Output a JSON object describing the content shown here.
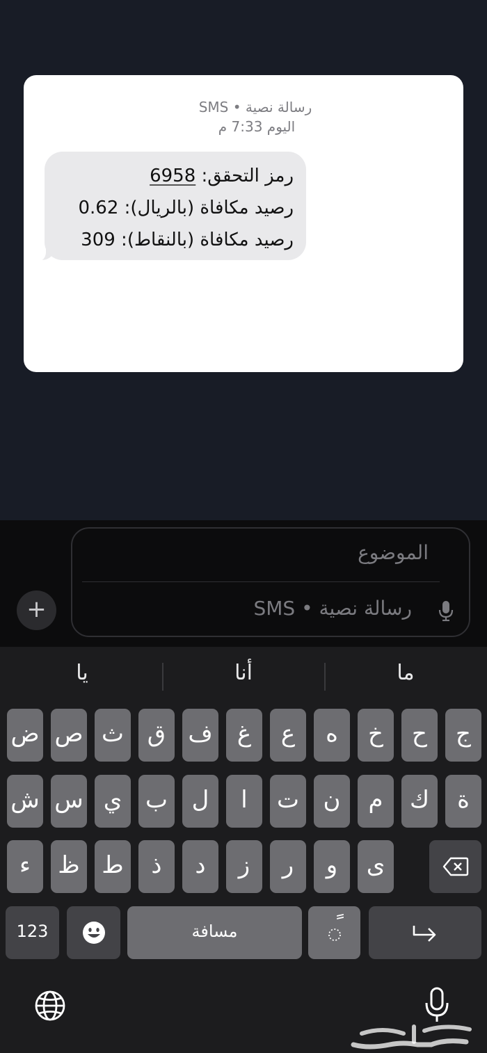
{
  "message": {
    "header_line1": "رسالة نصية • SMS",
    "header_line2": "اليوم 7:33 م",
    "lines": [
      {
        "label": "رمز التحقق: ",
        "value": "6958"
      },
      {
        "label": "رصيد مكافاة (بالريال): ",
        "value": "0.62"
      },
      {
        "label": "رصيد مكافاة (بالنقاط): ",
        "value": "309"
      }
    ]
  },
  "compose": {
    "subject_placeholder": "الموضوع",
    "message_placeholder": "رسالة نصية • SMS",
    "plus_label": "+"
  },
  "suggestions": [
    "ما",
    "أنا",
    "يا"
  ],
  "keyboard": {
    "row1": [
      "ج",
      "ح",
      "خ",
      "ه",
      "ع",
      "غ",
      "ف",
      "ق",
      "ث",
      "ص",
      "ض"
    ],
    "row2": [
      "ة",
      "ك",
      "م",
      "ن",
      "ت",
      "ا",
      "ل",
      "ب",
      "ي",
      "س",
      "ش"
    ],
    "row3": [
      "ى",
      "و",
      "ر",
      "ز",
      "د",
      "ذ",
      "ط",
      "ظ",
      "ء"
    ],
    "numbers_label": "123",
    "space_label": "مسافة",
    "tanween_label": "ً",
    "icons": {
      "backspace": "backspace-icon",
      "emoji": "emoji-icon",
      "return": "return-icon",
      "globe": "globe-icon",
      "dictation": "microphone-icon"
    }
  },
  "watermark_text": "حراج",
  "colors": {
    "background_dim": "#181c26",
    "bubble": "#e9e9eb",
    "keyboard_bg": "#1c1c1e",
    "key_light": "#6d6d71",
    "key_dark": "#434347"
  }
}
